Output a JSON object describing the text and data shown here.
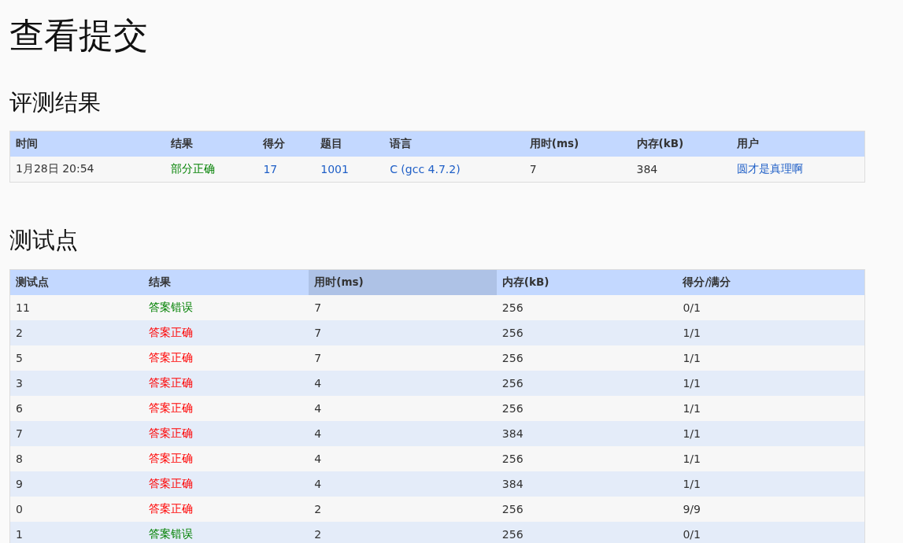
{
  "page_title": "查看提交",
  "judge_section": {
    "heading": "评测结果",
    "columns": [
      {
        "label": "时间"
      },
      {
        "label": "结果"
      },
      {
        "label": "得分"
      },
      {
        "label": "题目"
      },
      {
        "label": "语言"
      },
      {
        "label": "用时(ms)"
      },
      {
        "label": "内存(kB)"
      },
      {
        "label": "用户"
      }
    ],
    "cells": [
      {
        "text": "1月28日 20:54",
        "kind": "text"
      },
      {
        "text": "部分正确",
        "kind": "status",
        "color": "#008000"
      },
      {
        "text": "17",
        "kind": "link"
      },
      {
        "text": "1001",
        "kind": "link"
      },
      {
        "text": "C (gcc 4.7.2)",
        "kind": "link"
      },
      {
        "text": "7",
        "kind": "text"
      },
      {
        "text": "384",
        "kind": "text"
      },
      {
        "text": "圆才是真理啊",
        "kind": "link"
      }
    ]
  },
  "testcase_section": {
    "heading": "测试点",
    "columns": [
      {
        "label": "测试点",
        "sorted": false
      },
      {
        "label": "结果",
        "sorted": false
      },
      {
        "label": "用时(ms)",
        "sorted": true
      },
      {
        "label": "内存(kB)",
        "sorted": false
      },
      {
        "label": "得分/满分",
        "sorted": false
      }
    ],
    "rows": [
      {
        "case": "11",
        "result": "答案错误",
        "color": "#008000",
        "time": "7",
        "memory": "256",
        "score": "0/1"
      },
      {
        "case": "2",
        "result": "答案正确",
        "color": "#ff0000",
        "time": "7",
        "memory": "256",
        "score": "1/1"
      },
      {
        "case": "5",
        "result": "答案正确",
        "color": "#ff0000",
        "time": "7",
        "memory": "256",
        "score": "1/1"
      },
      {
        "case": "3",
        "result": "答案正确",
        "color": "#ff0000",
        "time": "4",
        "memory": "256",
        "score": "1/1"
      },
      {
        "case": "6",
        "result": "答案正确",
        "color": "#ff0000",
        "time": "4",
        "memory": "256",
        "score": "1/1"
      },
      {
        "case": "7",
        "result": "答案正确",
        "color": "#ff0000",
        "time": "4",
        "memory": "384",
        "score": "1/1"
      },
      {
        "case": "8",
        "result": "答案正确",
        "color": "#ff0000",
        "time": "4",
        "memory": "256",
        "score": "1/1"
      },
      {
        "case": "9",
        "result": "答案正确",
        "color": "#ff0000",
        "time": "4",
        "memory": "384",
        "score": "1/1"
      },
      {
        "case": "0",
        "result": "答案正确",
        "color": "#ff0000",
        "time": "2",
        "memory": "256",
        "score": "9/9"
      },
      {
        "case": "1",
        "result": "答案错误",
        "color": "#008000",
        "time": "2",
        "memory": "256",
        "score": "0/1"
      }
    ]
  }
}
